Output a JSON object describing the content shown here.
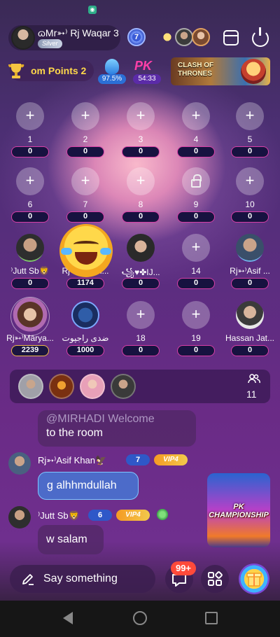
{
  "header": {
    "host_name": "ɷMr➳⁾ Rj Waqar 3",
    "host_tier": "Silver",
    "room_level": "7"
  },
  "points": {
    "label": "om Points 2",
    "percent": "97.5%",
    "pk_label": "PK",
    "pk_time": "54:33",
    "banner_text": "CLASH OF THRONES"
  },
  "seats": {
    "row1": [
      {
        "name": "1",
        "count": "0"
      },
      {
        "name": "2",
        "count": "0"
      },
      {
        "name": "3",
        "count": "0"
      },
      {
        "name": "4",
        "count": "0"
      },
      {
        "name": "5",
        "count": "0"
      }
    ],
    "row2": [
      {
        "name": "6",
        "count": "0"
      },
      {
        "name": "7",
        "count": "0"
      },
      {
        "name": "8",
        "count": "0"
      },
      {
        "name": "9",
        "count": "0",
        "locked": true
      },
      {
        "name": "10",
        "count": "0"
      }
    ],
    "row3": [
      {
        "name": "⁾Jutt Sb🦁",
        "count": "0"
      },
      {
        "name": "Rj➳⁾Minah...",
        "count": "1174"
      },
      {
        "name": "꧁♥✤IJ...",
        "count": "0"
      },
      {
        "name": "14",
        "count": "0"
      },
      {
        "name": "Rj➳⁾Asif ...",
        "count": "0"
      }
    ],
    "row4": [
      {
        "name": "Rj➳⁾Mārya...",
        "count": "2239"
      },
      {
        "name": "ضدی راجپوت",
        "count": "1000"
      },
      {
        "name": "18",
        "count": "0"
      },
      {
        "name": "19",
        "count": "0"
      },
      {
        "name": "Hassan Jat...",
        "count": "0"
      }
    ]
  },
  "viewers": {
    "count": "11"
  },
  "chat": {
    "welcome_line1": "@MIRHADI Welcome",
    "welcome_line2": "to the room",
    "msg1": {
      "name": "Rj➳⁾Asif Khan🦅",
      "level": "7",
      "vip": "VIP4",
      "text": "g alhhmdullah"
    },
    "msg2": {
      "name": "⁾Jutt Sb🦁",
      "level": "6",
      "vip": "VIP4",
      "text": "w salam"
    },
    "promo_text": "PK CHAMPIONSHIP"
  },
  "bottom": {
    "say_placeholder": "Say something",
    "message_badge": "99+"
  },
  "colors": {
    "accent_pink": "#d73fa6",
    "gold": "#f0b84b",
    "level_blue": "#2f58c8"
  }
}
